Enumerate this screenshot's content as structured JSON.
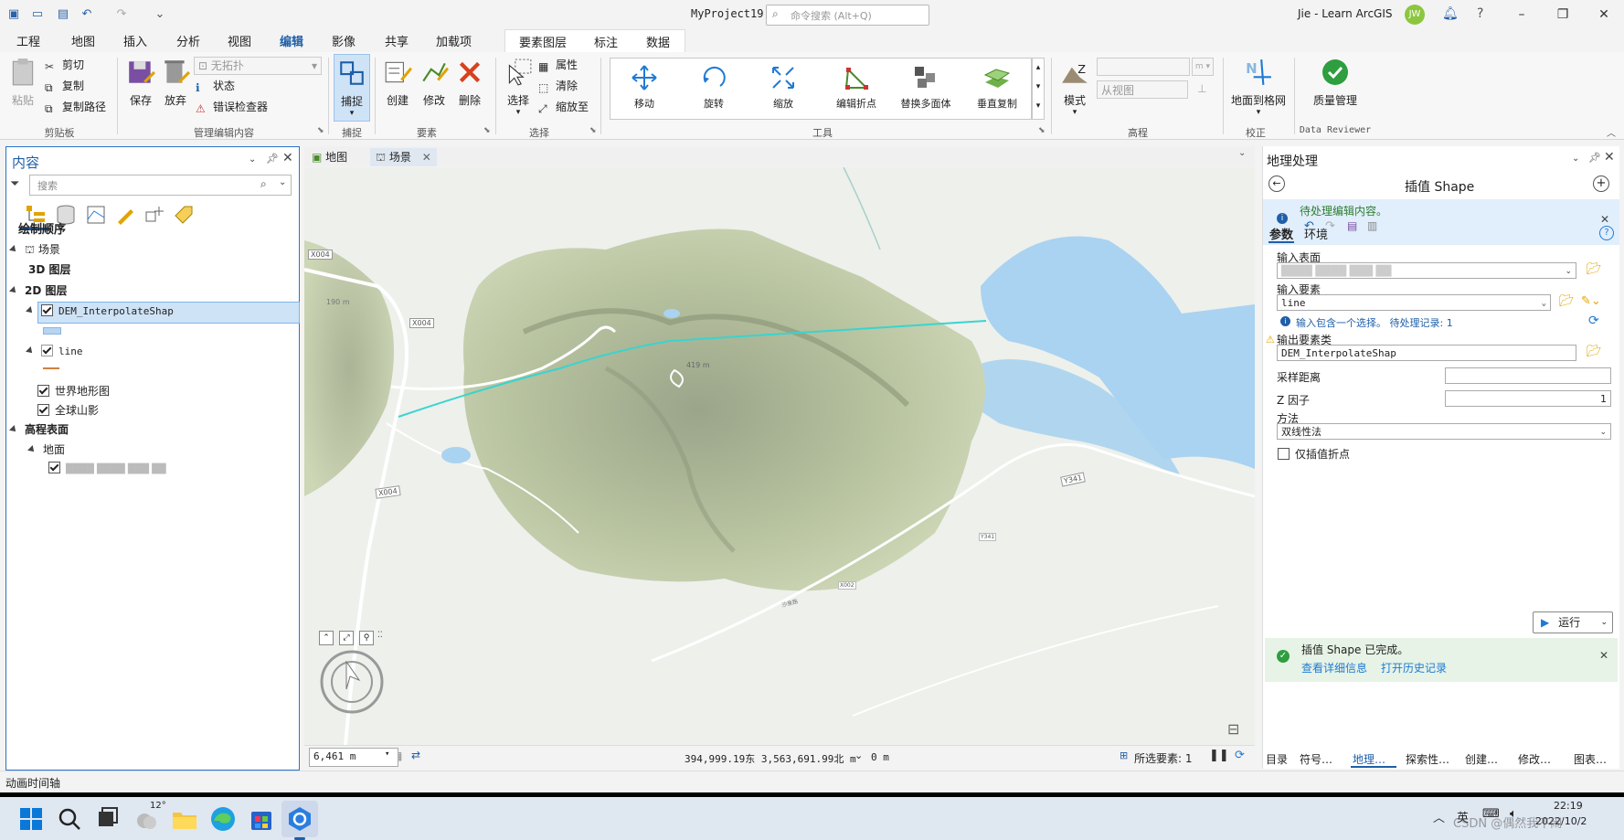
{
  "title_bar": {
    "project_title": "MyProject19",
    "search_placeholder": "命令搜索 (Alt+Q)",
    "user": "Jie - Learn ArcGIS",
    "avatar_initials": "JW"
  },
  "ribbon_tabs": [
    "工程",
    "地图",
    "插入",
    "分析",
    "视图",
    "编辑",
    "影像",
    "共享",
    "加载项"
  ],
  "active_tab": "编辑",
  "context_tabs": [
    "要素图层",
    "标注",
    "数据"
  ],
  "ribbon": {
    "clipboard": {
      "paste": "粘贴",
      "cut": "剪切",
      "copy": "复制",
      "copy_path": "复制路径",
      "group": "剪贴板"
    },
    "manage_edits": {
      "save": "保存",
      "discard": "放弃",
      "topology": "无拓扑",
      "status": "状态",
      "error_inspector": "错误检查器",
      "group": "管理编辑内容"
    },
    "snapping": {
      "snap": "捕捉",
      "group": "捕捉"
    },
    "features": {
      "create": "创建",
      "modify": "修改",
      "delete": "删除",
      "group": "要素"
    },
    "selection": {
      "select": "选择",
      "attributes": "属性",
      "clear": "清除",
      "zoom_to": "缩放至",
      "group": "选择"
    },
    "tools": {
      "items": [
        "移动",
        "旋转",
        "缩放",
        "编辑折点",
        "替换多面体",
        "垂直复制"
      ],
      "group": "工具"
    },
    "elevation": {
      "mode": "模式",
      "from_view": "从视图",
      "group": "高程"
    },
    "correction": {
      "ground_to_grid": "地面到格网",
      "group": "校正"
    },
    "data_reviewer": {
      "quality": "质量管理",
      "group": "Data Reviewer"
    }
  },
  "contents": {
    "title": "内容",
    "search_placeholder": "搜索",
    "drawing_order": "绘制顺序",
    "rows": {
      "scene": "场景",
      "layers_3d": "3D 图层",
      "layers_2d": "2D 图层",
      "dem": "DEM_InterpolateShap",
      "line": "line",
      "topo": "世界地形图",
      "hillshade": "全球山影",
      "elev_surfaces": "高程表面",
      "ground": "地面",
      "ground_layer": "████ ████ ███ ██"
    }
  },
  "map": {
    "tabs": [
      "地图",
      "场景"
    ],
    "labels": {
      "x004a": "X004",
      "x004b": "X004",
      "x004c": "X004",
      "m190": "190 m",
      "m419": "419 m",
      "y341": "Y341",
      "y341b": "Y341",
      "x002": "X002",
      "road": "沙泉路"
    },
    "scale": "6,461 m",
    "coords": "394,999.19东 3,563,691.99北 m",
    "z": "0 m",
    "selected_features": "所选要素: 1"
  },
  "geoprocessing": {
    "title": "地理处理",
    "tool_title": "插值 Shape",
    "pending_edits": "待处理编辑内容。",
    "tab_params": "参数",
    "tab_env": "环境",
    "input_surface_label": "输入表面",
    "input_surface_value": "████ ████ ███ ██",
    "input_features_label": "输入要素",
    "input_features_value": "line",
    "selection_info": "输入包含一个选择。 待处理记录: 1",
    "output_label": "输出要素类",
    "output_value": "DEM_InterpolateShap",
    "sample_distance_label": "采样距离",
    "sample_distance_value": "",
    "z_factor_label": "Z 因子",
    "z_factor_value": "1",
    "method_label": "方法",
    "method_value": "双线性法",
    "vertices_only": "仅插值折点",
    "run": "运行",
    "done_msg": "插值 Shape 已完成。",
    "view_details": "查看详细信息",
    "open_history": "打开历史记录"
  },
  "bottom_tabs": [
    "目录",
    "符号…",
    "地理…",
    "探索性…",
    "创建…",
    "修改…",
    "图表…"
  ],
  "bottom_active": "地理…",
  "animation_timeline": "动画时间轴",
  "taskbar": {
    "temperature": "12°",
    "ime": "英",
    "time": "22:19",
    "date": "2022/10/2",
    "watermark": "CSDN @偶然我不闹"
  },
  "colors": {
    "accent": "#1f5fa8",
    "line_feature": "#39d4cf",
    "lake": "#a9d3f0",
    "terrain": "#c9d3b0",
    "success": "#2e9e3e"
  }
}
